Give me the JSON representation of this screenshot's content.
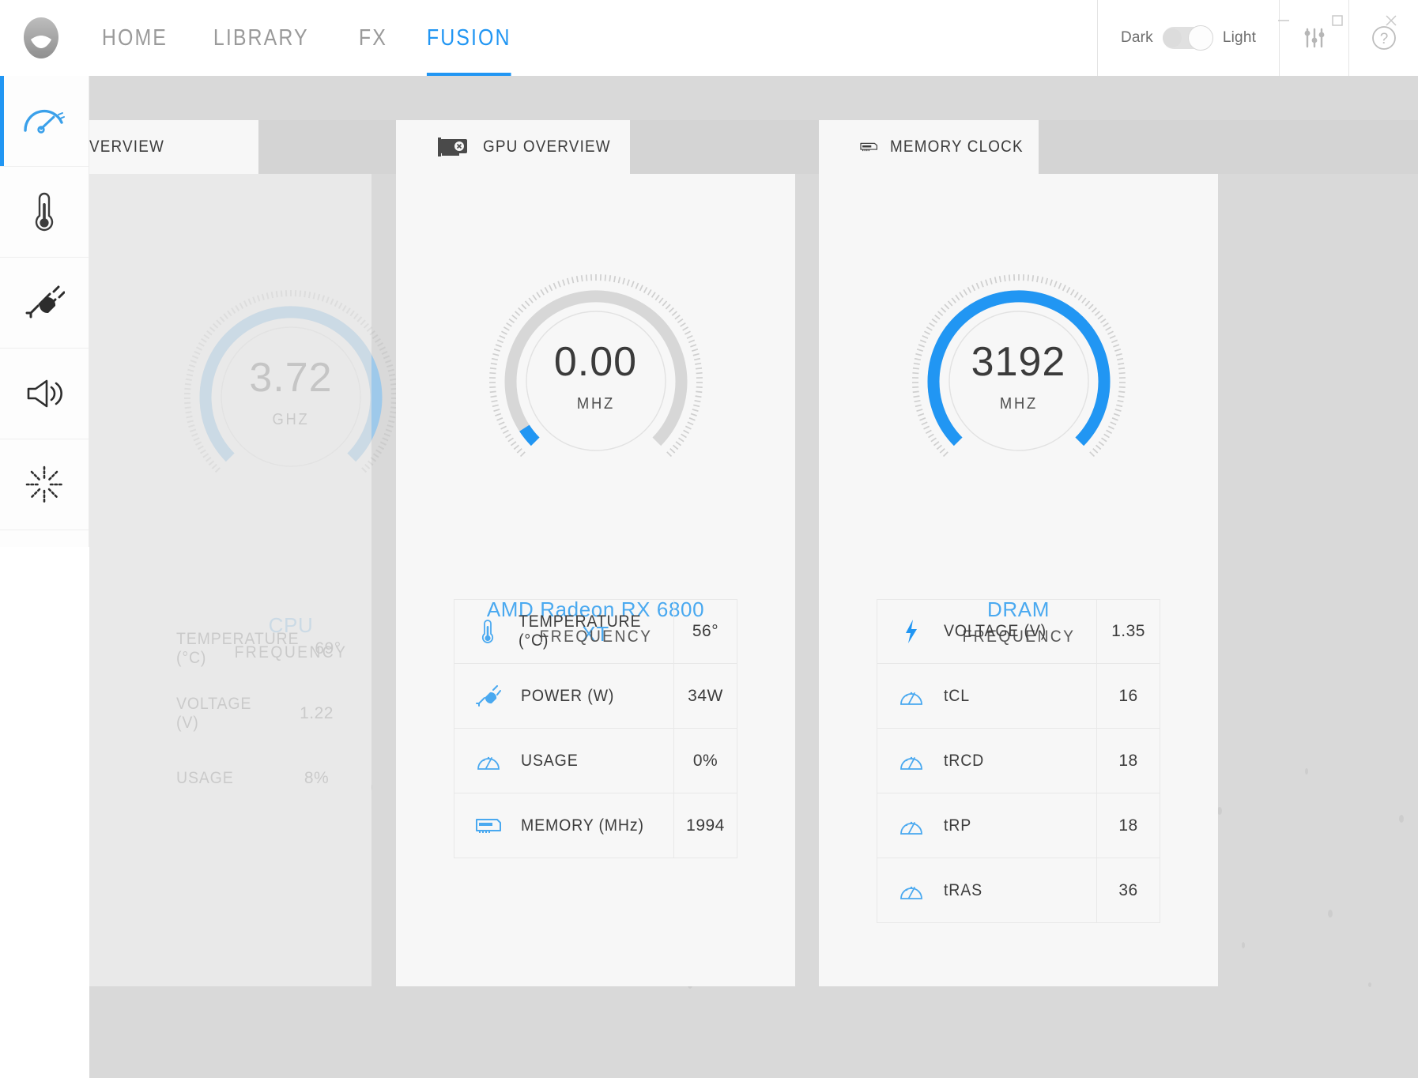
{
  "window": {
    "minimize_label": "minimize-icon",
    "maximize_label": "maximize-icon",
    "close_label": "close-icon"
  },
  "topbar": {
    "logo": "alienware-head-icon",
    "nav": [
      {
        "label": "HOME",
        "active": false
      },
      {
        "label": "LIBRARY",
        "active": false
      },
      {
        "label": "FX",
        "active": false
      },
      {
        "label": "FUSION",
        "active": true
      }
    ],
    "theme": {
      "dark_label": "Dark",
      "light_label": "Light",
      "selected": "Light"
    },
    "settings_icon": "sliders-icon",
    "help_icon": "help-circle-icon"
  },
  "sidebar": {
    "items": [
      {
        "name": "performance",
        "icon": "gauge-icon",
        "active": true
      },
      {
        "name": "thermals",
        "icon": "thermometer-icon",
        "active": false
      },
      {
        "name": "power",
        "icon": "power-plug-icon",
        "active": false
      },
      {
        "name": "audio",
        "icon": "speaker-icon",
        "active": false
      },
      {
        "name": "lighting",
        "icon": "sparkle-icon",
        "active": false
      }
    ]
  },
  "cards": [
    {
      "id": "cpu",
      "tab_label": "VERVIEW",
      "tab_icon": "cpu-icon",
      "dimmed": true,
      "gauge": {
        "value": "3.72",
        "unit": "GHZ",
        "name": "CPU",
        "subtitle": "FREQUENCY",
        "percent": 62,
        "arc_color": "#9ec9ea"
      },
      "stats": [
        {
          "icon": "thermometer-icon",
          "label": "TEMPERATURE (°C)",
          "value": "69°"
        },
        {
          "icon": "power-plug-icon",
          "label": "VOLTAGE (V)",
          "value": "1.22"
        },
        {
          "icon": "gauge-icon",
          "label": "USAGE",
          "value": "8%"
        }
      ]
    },
    {
      "id": "gpu",
      "tab_label": "GPU OVERVIEW",
      "tab_icon": "graphics-card-icon",
      "dimmed": false,
      "gauge": {
        "value": "0.00",
        "unit": "MHZ",
        "name": "AMD Radeon RX 6800 XT",
        "subtitle": "FREQUENCY",
        "percent": 3,
        "arc_color": "#2196f3"
      },
      "stats": [
        {
          "icon": "thermometer-icon",
          "label": "TEMPERATURE (°C)",
          "value": "56°"
        },
        {
          "icon": "power-plug-icon",
          "label": "POWER (W)",
          "value": "34W"
        },
        {
          "icon": "gauge-icon",
          "label": "USAGE",
          "value": "0%"
        },
        {
          "icon": "memory-stick-icon",
          "label": "MEMORY (MHz)",
          "value": "1994"
        }
      ]
    },
    {
      "id": "dram",
      "tab_label": "MEMORY CLOCK",
      "tab_icon": "memory-stick-icon",
      "dimmed": false,
      "gauge": {
        "value": "3192",
        "unit": "MHZ",
        "name": "DRAM",
        "subtitle": "FREQUENCY",
        "percent": 92,
        "arc_color": "#2196f3"
      },
      "stats": [
        {
          "icon": "lightning-icon",
          "label": "VOLTAGE (V)",
          "value": "1.35"
        },
        {
          "icon": "gauge-icon",
          "label": "tCL",
          "value": "16"
        },
        {
          "icon": "gauge-icon",
          "label": "tRCD",
          "value": "18"
        },
        {
          "icon": "gauge-icon",
          "label": "tRP",
          "value": "18"
        },
        {
          "icon": "gauge-icon",
          "label": "tRAS",
          "value": "36"
        }
      ]
    }
  ],
  "colors": {
    "accent": "#2196f3",
    "accent_soft": "#9ec9ea",
    "text": "#3c3c3c",
    "muted": "#9a9a9a",
    "card_bg": "#f7f7f7",
    "stage_bg": "#d9d9d9"
  }
}
